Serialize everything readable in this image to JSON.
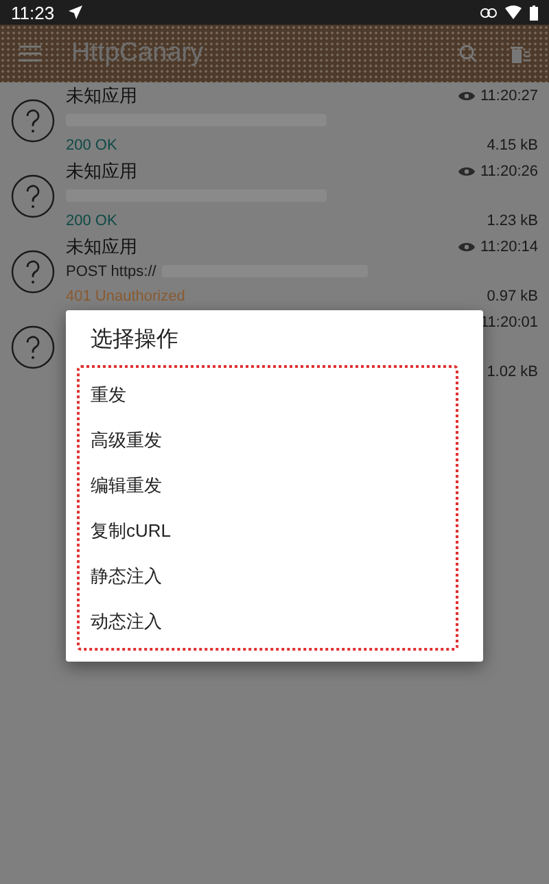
{
  "status_bar": {
    "time": "11:23"
  },
  "toolbar": {
    "title": "HttpCanary"
  },
  "requests": [
    {
      "app": "未知应用",
      "time": "11:20:27",
      "status": "200 OK",
      "color": "#0f4a46",
      "size": "4.15 kB"
    },
    {
      "app": "未知应用",
      "time": "11:20:26",
      "status": "200 OK",
      "color": "#0f4a46",
      "size": "1.23 kB"
    },
    {
      "app": "未知应用",
      "time": "11:20:14",
      "line": "POST https://",
      "status": "401 Unauthorized",
      "color": "#8a5a30",
      "size": "0.97 kB"
    },
    {
      "time": "11:20:01",
      "size": "1.02 kB"
    }
  ],
  "dialog": {
    "title": "选择操作",
    "options": [
      "重发",
      "高级重发",
      "编辑重发",
      "复制cURL",
      "静态注入",
      "动态注入"
    ]
  }
}
